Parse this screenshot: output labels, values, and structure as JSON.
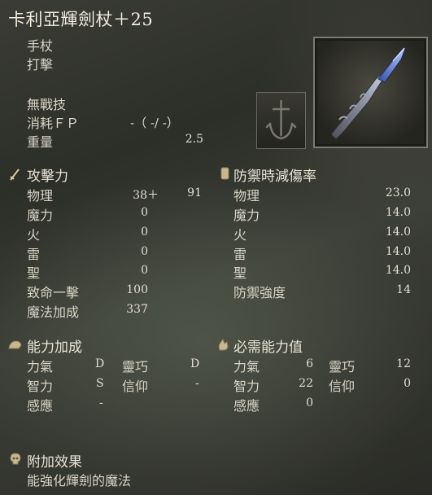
{
  "weapon": {
    "name": "卡利亞輝劍杖＋25",
    "category": "手杖",
    "attack_type": "打擊",
    "skill": "無戰技",
    "fp_label": "消耗ＦＰ",
    "fp_value": "-（ -/ -）",
    "weight_label": "重量",
    "weight_value": "2.5"
  },
  "attack": {
    "header": "攻擊力",
    "rows": [
      {
        "label": "物理",
        "value": "38＋",
        "extra": "91"
      },
      {
        "label": "魔力",
        "value": "0"
      },
      {
        "label": "火",
        "value": "0"
      },
      {
        "label": "雷",
        "value": "0"
      },
      {
        "label": "聖",
        "value": "0"
      },
      {
        "label": "致命一擊",
        "value": "100"
      },
      {
        "label": "魔法加成",
        "value": "337"
      }
    ]
  },
  "guard": {
    "header": "防禦時減傷率",
    "rows": [
      {
        "label": "物理",
        "value": "23.0"
      },
      {
        "label": "魔力",
        "value": "14.0"
      },
      {
        "label": "火",
        "value": "14.0"
      },
      {
        "label": "雷",
        "value": "14.0"
      },
      {
        "label": "聖",
        "value": "14.0"
      },
      {
        "label": "防禦強度",
        "value": "14"
      }
    ]
  },
  "scaling": {
    "header": "能力加成",
    "rows": [
      {
        "l1": "力氣",
        "v1": "D",
        "l2": "靈巧",
        "v2": "D"
      },
      {
        "l1": "智力",
        "v1": "S",
        "l2": "信仰",
        "v2": "-"
      },
      {
        "l1": "感應",
        "v1": "-"
      }
    ]
  },
  "requirements": {
    "header": "必需能力值",
    "rows": [
      {
        "l1": "力氣",
        "v1": "6",
        "l2": "靈巧",
        "v2": "12"
      },
      {
        "l1": "智力",
        "v1": "22",
        "l2": "信仰",
        "v2": "0"
      },
      {
        "l1": "感應",
        "v1": "0"
      }
    ]
  },
  "passive": {
    "header": "附加效果",
    "text": "能強化輝劍的魔法"
  },
  "icons": {
    "attack": "sword-icon",
    "guard": "shield-icon",
    "scaling": "arm-icon",
    "requirements": "hand-icon",
    "passive": "skull-icon",
    "affinity": "anchor-crest-icon"
  },
  "colors": {
    "text": "#e6e2d2",
    "title": "#f1ecdd",
    "blade": "#6a8fe0"
  }
}
